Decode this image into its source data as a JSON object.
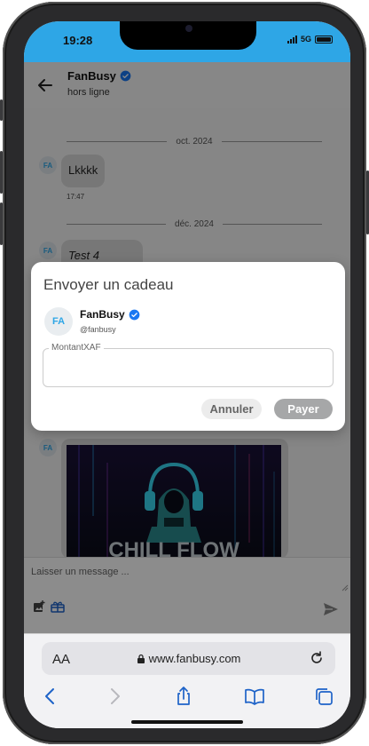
{
  "status_bar": {
    "time": "19:28",
    "network": "5G"
  },
  "chat": {
    "name": "FanBusy",
    "status": "hors ligne"
  },
  "messages": {
    "divider_1": "oct. 2024",
    "avatar_initials": "FA",
    "msg_1_text": "Lkkkk",
    "msg_1_time": "17:47",
    "divider_2": "déc. 2024",
    "msg_2_text": "Test 4",
    "poster_text": "CHILL FLOW"
  },
  "composer": {
    "placeholder": "Laisser un message ..."
  },
  "modal": {
    "title": "Envoyer un cadeau",
    "avatar_initials": "FA",
    "name": "FanBusy",
    "handle": "@fanbusy",
    "amount_label": "MontantXAF",
    "amount_value": "",
    "cancel_label": "Annuler",
    "pay_label": "Payer"
  },
  "browser": {
    "aa_label": "AA",
    "url": "www.fanbusy.com"
  },
  "colors": {
    "accent": "#2ea6e6",
    "verified": "#1877f2",
    "overlay": "rgba(0,0,0,0.45)"
  }
}
